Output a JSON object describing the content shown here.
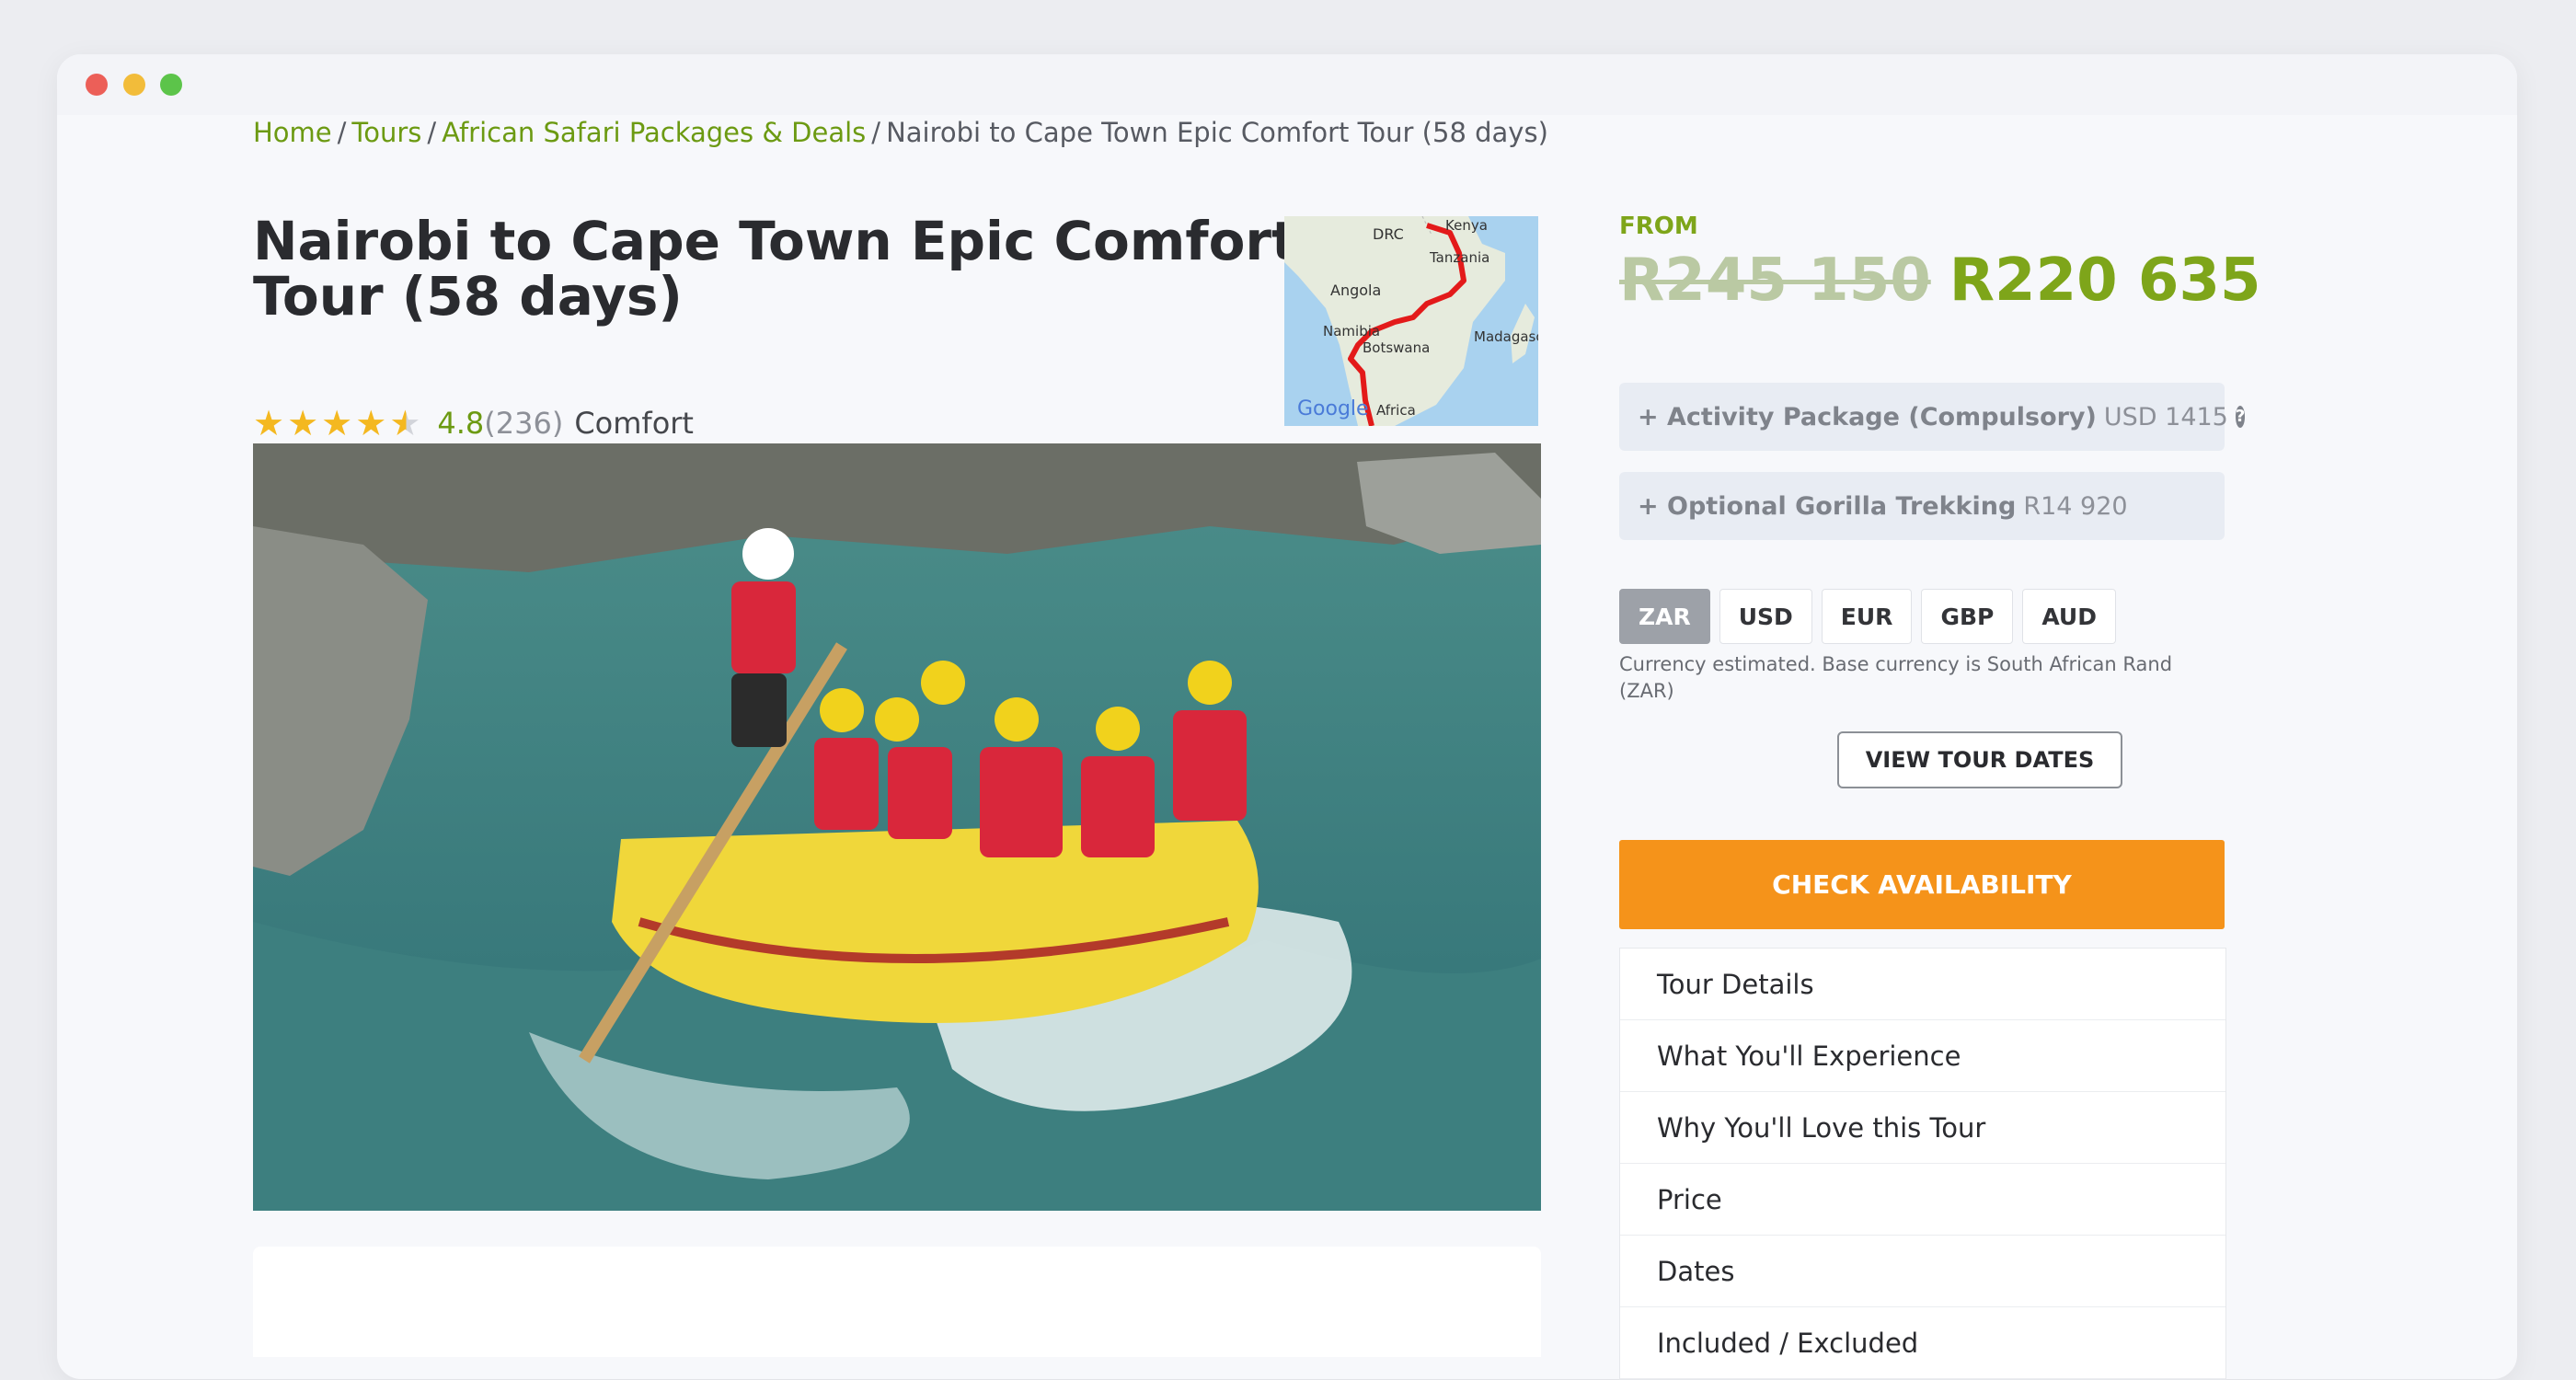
{
  "breadcrumb": {
    "items": [
      "Home",
      "Tours",
      "African Safari Packages & Deals"
    ],
    "current": "Nairobi to Cape Town Epic Comfort Tour (58 days)",
    "separator": "/"
  },
  "tour": {
    "title": "Nairobi to Cape Town Epic Comfort Tour (58 days)",
    "rating": "4.8",
    "reviews": "(236)",
    "level": "Comfort",
    "stars": 4.5
  },
  "map": {
    "labels": [
      "DRC",
      "Kenya",
      "Tanzania",
      "Angola",
      "Namibia",
      "Botswana",
      "Madagascar",
      "Africa"
    ],
    "logo": "Google"
  },
  "pricing": {
    "from_label": "FROM",
    "old_price": "R245 150",
    "new_price": "R220 635",
    "addons": [
      {
        "name": "+ Activity Package (Compulsory)",
        "value": "USD 1415",
        "help": "?"
      },
      {
        "name": "+ Optional Gorilla Trekking",
        "value": "R14 920"
      }
    ]
  },
  "currency": {
    "options": [
      "ZAR",
      "USD",
      "EUR",
      "GBP",
      "AUD"
    ],
    "selected": "ZAR",
    "note": "Currency estimated. Base currency is South African Rand (ZAR)"
  },
  "actions": {
    "view_dates": "VIEW TOUR DATES",
    "check_availability": "CHECK AVAILABILITY"
  },
  "sections": [
    "Tour Details",
    "What You'll Experience",
    "Why You'll Love this Tour",
    "Price",
    "Dates",
    "Included / Excluded"
  ],
  "colors": {
    "accent_green": "#7ea51a",
    "link_green": "#6c9a12",
    "cta_orange": "#f5931a",
    "star": "#f4b820"
  }
}
